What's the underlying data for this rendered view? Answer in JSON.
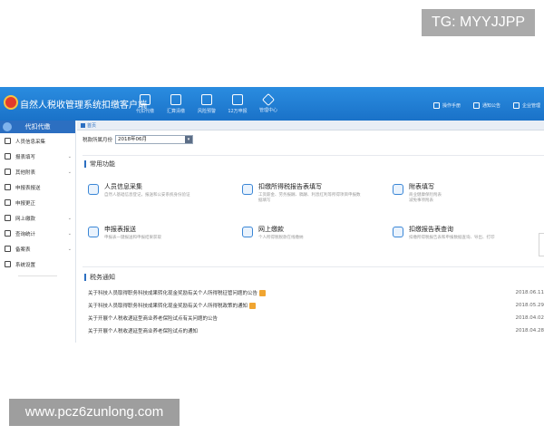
{
  "watermarks": {
    "top": "TG: MYYJJPP",
    "bottom": "www.pcz6zunlong.com"
  },
  "app": {
    "title": "自然人税收管理系统扣缴客户端",
    "toolbar": [
      {
        "label": "代扣代缴",
        "icon": "chart-icon"
      },
      {
        "label": "汇算清缴",
        "icon": "document-icon"
      },
      {
        "label": "风险预警",
        "icon": "alert-icon"
      },
      {
        "label": "12万申报",
        "icon": "form-icon"
      },
      {
        "label": "管理中心",
        "icon": "diamond-icon"
      }
    ],
    "top_right": [
      {
        "label": "操作手册",
        "icon": "book-icon"
      },
      {
        "label": "通知公告",
        "icon": "mail-icon"
      },
      {
        "label": "企业管理",
        "icon": "building-icon"
      }
    ]
  },
  "sidebar": {
    "header": "代扣代缴",
    "items": [
      {
        "label": "人员信息采集",
        "icon": "person-icon",
        "has_children": false
      },
      {
        "label": "报表填写",
        "icon": "form-icon",
        "has_children": true
      },
      {
        "label": "其他附表",
        "icon": "grid-icon",
        "has_children": true
      },
      {
        "label": "申报表报送",
        "icon": "upload-icon",
        "has_children": false
      },
      {
        "label": "申报更正",
        "icon": "edit-icon",
        "has_children": false
      },
      {
        "label": "网上缴款",
        "icon": "payment-icon",
        "has_children": true
      },
      {
        "label": "查询统计",
        "icon": "search-icon",
        "has_children": true
      },
      {
        "label": "备案表",
        "icon": "file-icon",
        "has_children": true
      },
      {
        "label": "系统设置",
        "icon": "gear-icon",
        "has_children": false
      }
    ]
  },
  "main": {
    "home_tab": "首页",
    "period_label": "税款所属月份",
    "period_value": "2018年06月",
    "common_functions_title": "常用功能",
    "functions": [
      {
        "title": "人员信息采集",
        "desc_lines": [
          "自然人基础信息登记，报送和公安系统身份验证"
        ],
        "icon": "person-card-icon"
      },
      {
        "title": "扣缴所得税报告表填写",
        "desc_lines": [
          "工资薪金、劳务报酬、稿酬、利息红利等所得项目申报数",
          "据填写"
        ],
        "icon": "report-icon"
      },
      {
        "title": "附表填写",
        "desc_lines": [
          "商业健康保险附表",
          "减免事项附表"
        ],
        "icon": "edit-icon"
      },
      {
        "title": "申报表报送",
        "desc_lines": [
          "申报表一键报送和申报结果获取"
        ],
        "icon": "upload-icon"
      },
      {
        "title": "网上缴款",
        "desc_lines": [
          "个人所得税税款在线缴纳"
        ],
        "icon": "payment-icon"
      },
      {
        "title": "扣缴报告表查询",
        "desc_lines": [
          "扣缴所得税报告表和申报数据查询、导出、打印"
        ],
        "icon": "search-report-icon"
      }
    ],
    "notices_title": "税务通知",
    "notices": [
      {
        "text": "关于科技人员取得职务科技成果转化现金奖励有关个人所得税征管问题的公告",
        "date": "2018.06.11",
        "badge": true
      },
      {
        "text": "关于科技人员取得职务科技成果转化现金奖励有关个人所得税政策的通知",
        "date": "2018.05.29",
        "badge": true
      },
      {
        "text": "关于开展个人税收递延型商业养老保险试点有关问题的公告",
        "date": "2018.04.02",
        "badge": false
      },
      {
        "text": "关于开展个人税收递延型商业养老保险试点的通知",
        "date": "2018.04.28",
        "badge": false
      }
    ]
  },
  "colors": {
    "titlebar": "#1a72c8",
    "accent": "#2c6fc1",
    "badge": "#f0a531"
  }
}
